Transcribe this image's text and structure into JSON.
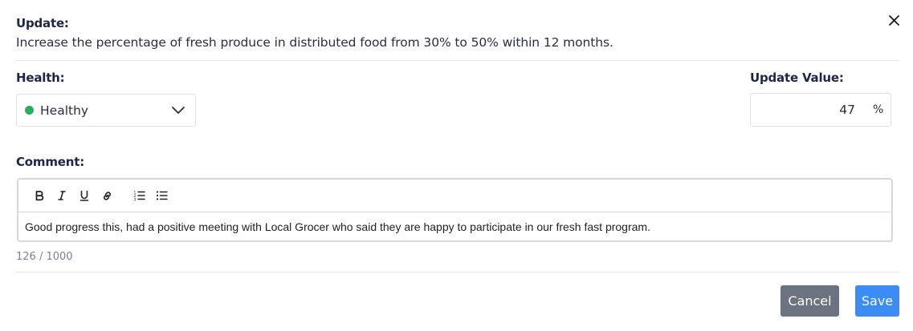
{
  "dialog": {
    "update_label": "Update:",
    "objective": "Increase the percentage of fresh produce in distributed food from 30% to 50% within 12 months.",
    "close_icon": "close-icon"
  },
  "health": {
    "label": "Health:",
    "selected": "Healthy",
    "status_color": "#23b25a"
  },
  "update_value": {
    "label": "Update Value:",
    "value": "47",
    "unit": "%"
  },
  "comment": {
    "label": "Comment:",
    "toolbar": [
      "bold-icon",
      "italic-icon",
      "underline-icon",
      "link-icon",
      "ordered-list-icon",
      "bullet-list-icon"
    ],
    "text": "Good progress this, had a positive meeting with Local Grocer who said they are happy to participate in our fresh fast program.",
    "counter": "126 / 1000"
  },
  "actions": {
    "cancel": "Cancel",
    "save": "Save",
    "cancel_color": "#6b7280",
    "save_color": "#3b8cf5"
  }
}
